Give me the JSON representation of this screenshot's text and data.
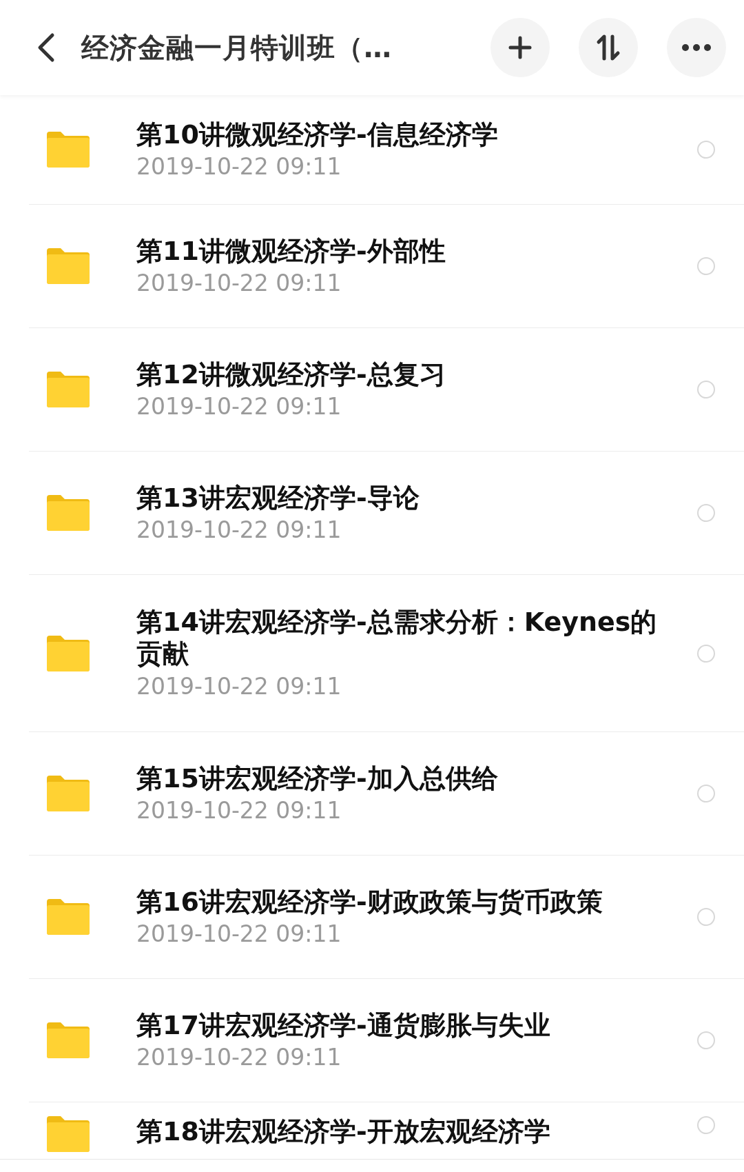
{
  "header": {
    "title": "经济金融一月特训班（…"
  },
  "files": [
    {
      "name": "第10讲微观经济学-信息经济学",
      "date": "2019-10-22  09:11",
      "selected": false
    },
    {
      "name": "第11讲微观经济学-外部性",
      "date": "2019-10-22  09:11",
      "selected": false
    },
    {
      "name": "第12讲微观经济学-总复习",
      "date": "2019-10-22  09:11",
      "selected": false
    },
    {
      "name": "第13讲宏观经济学-导论",
      "date": "2019-10-22  09:11",
      "selected": false
    },
    {
      "name": "第14讲宏观经济学-总需求分析：Keynes的贡献",
      "date": "2019-10-22  09:11",
      "selected": false
    },
    {
      "name": "第15讲宏观经济学-加入总供给",
      "date": "2019-10-22  09:11",
      "selected": false
    },
    {
      "name": "第16讲宏观经济学-财政政策与货币政策",
      "date": "2019-10-22  09:11",
      "selected": false
    },
    {
      "name": "第17讲宏观经济学-通货膨胀与失业",
      "date": "2019-10-22  09:11",
      "selected": false
    },
    {
      "name": "第18讲宏观经济学-开放宏观经济学",
      "selected": false
    }
  ]
}
